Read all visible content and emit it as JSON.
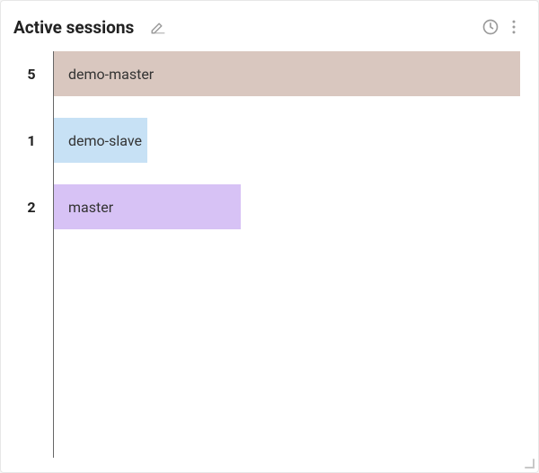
{
  "title": "Active sessions",
  "icons": {
    "edit": "pencil-icon",
    "history": "clock-icon",
    "menu": "more-vert-icon",
    "resize": "resize-handle-icon"
  },
  "chart_data": {
    "type": "bar",
    "orientation": "horizontal",
    "title": "Active sessions",
    "xlabel": "",
    "ylabel": "",
    "xlim": [
      0,
      5
    ],
    "categories": [
      "demo-master",
      "demo-slave",
      "master"
    ],
    "values": [
      5,
      1,
      2
    ],
    "colors": [
      "#d9c7bf",
      "#c7e1f5",
      "#d7c2f5"
    ]
  }
}
